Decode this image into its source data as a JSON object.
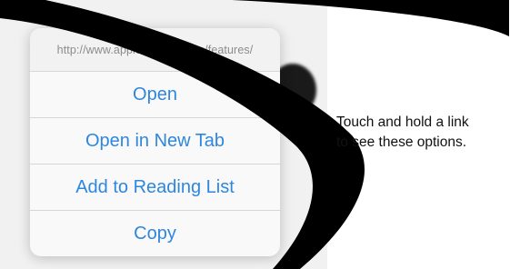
{
  "popover": {
    "url": "http://www.apple.com/iphone/features/",
    "items": [
      {
        "label": "Open"
      },
      {
        "label": "Open in New Tab"
      },
      {
        "label": "Add to Reading List"
      },
      {
        "label": "Copy"
      }
    ]
  },
  "caption": {
    "line1": "Touch and hold a link",
    "line2": "to see these options."
  },
  "colors": {
    "accent": "#2e86dd",
    "swoosh": "#000000"
  }
}
